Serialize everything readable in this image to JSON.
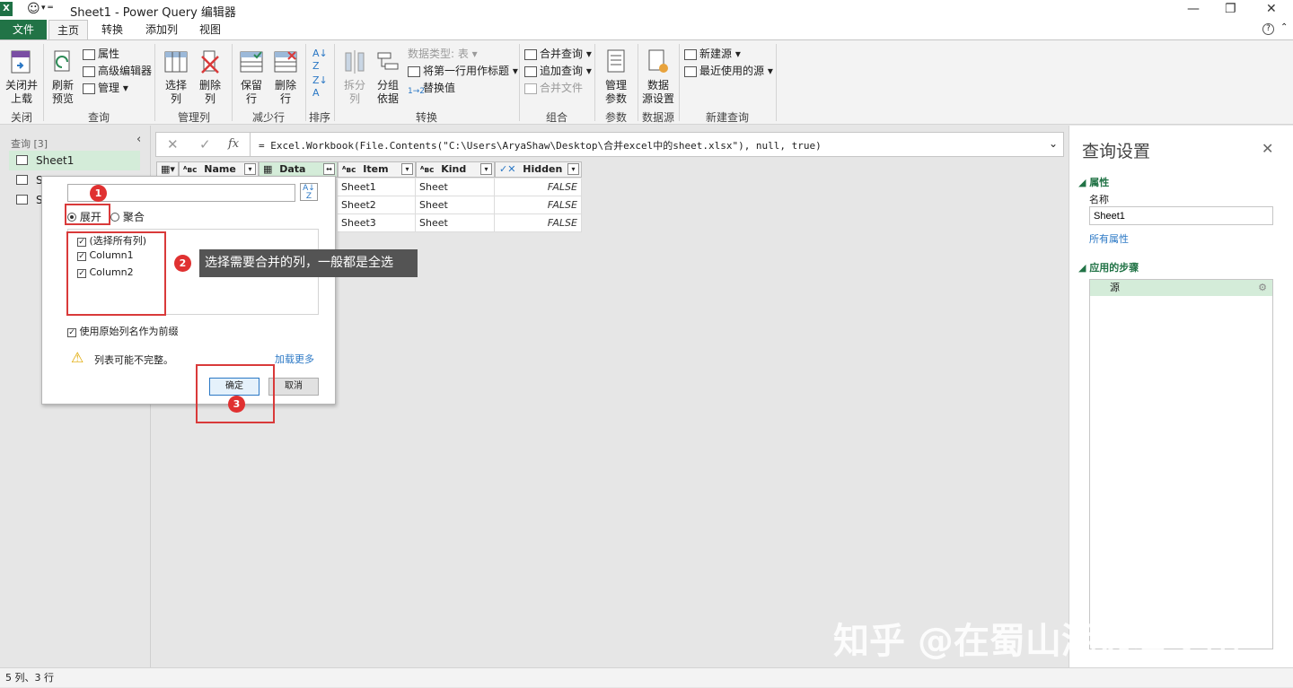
{
  "window": {
    "title": "Sheet1 - Power Query 编辑器"
  },
  "menu": [
    "文件",
    "主页",
    "转换",
    "添加列",
    "视图"
  ],
  "ribbon": {
    "close_load": "关闭并\n上载",
    "refresh_preview": "刷新\n预览",
    "properties": "属性",
    "advanced_editor": "高级编辑器",
    "manage": "管理",
    "choose_cols": "选择\n列",
    "remove_cols": "删除\n列",
    "keep_rows": "保留\n行",
    "remove_rows": "删除\n行",
    "split_col": "拆分\n列",
    "group_by": "分组\n依据",
    "data_type": "数据类型: 表",
    "first_row_header": "将第一行用作标题",
    "replace_values": "替换值",
    "merge_queries": "合并查询",
    "append_queries": "追加查询",
    "combine_files": "合并文件",
    "manage_params": "管理\n参数",
    "data_source_settings": "数据\n源设置",
    "new_source": "新建源",
    "recent_sources": "最近使用的源",
    "groups": [
      "关闭",
      "查询",
      "管理列",
      "减少行",
      "排序",
      "转换",
      "组合",
      "参数",
      "数据源",
      "新建查询"
    ]
  },
  "left_pane": {
    "header": "查询 [3]",
    "items": [
      "Sheet1",
      "S",
      "S"
    ]
  },
  "formula_bar": {
    "fx": "fx",
    "formula": "= Excel.Workbook(File.Contents(\"C:\\Users\\AryaShaw\\Desktop\\合并excel中的sheet.xlsx\"), null, true)"
  },
  "grid": {
    "columns": [
      "Name",
      "Data",
      "Item",
      "Kind",
      "Hidden"
    ],
    "column_types": [
      "ABC",
      "table",
      "ABC",
      "ABC",
      "bool"
    ],
    "rows": [
      [
        "Sheet1",
        "Sheet",
        "FALSE"
      ],
      [
        "Sheet2",
        "Sheet",
        "FALSE"
      ],
      [
        "Sheet3",
        "Sheet",
        "FALSE"
      ]
    ]
  },
  "dialog": {
    "search_value": "",
    "radio_expand": "展开",
    "radio_aggregate": "聚合",
    "checkboxes": [
      {
        "label": "(选择所有列)",
        "checked": true
      },
      {
        "label": "Column1",
        "checked": true
      },
      {
        "label": "Column2",
        "checked": true
      }
    ],
    "prefix_label": "使用原始列名作为前缀",
    "prefix_checked": true,
    "warning_text": "列表可能不完整。",
    "load_more": "加载更多",
    "ok": "确定",
    "cancel": "取消"
  },
  "annotations": {
    "badge1": "1",
    "badge2": "2",
    "badge3": "3",
    "tooltip": "选择需要合并的列，一般都是全选"
  },
  "right_panel": {
    "title": "查询设置",
    "properties_header": "属性",
    "name_label": "名称",
    "name_value": "Sheet1",
    "all_properties": "所有属性",
    "steps_header": "应用的步骤",
    "steps": [
      "源"
    ]
  },
  "status": "5 列、3 行",
  "watermark": "知乎 @在蜀山湖边看夕阳",
  "colors": {
    "excel_green": "#217346",
    "accent_blue": "#2b78c5",
    "highlight_red": "#d93a3a",
    "step_bg": "#d4ecd9"
  }
}
